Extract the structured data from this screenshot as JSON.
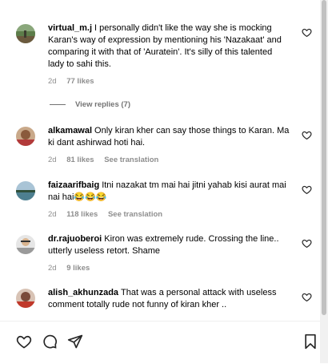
{
  "comments": [
    {
      "username": "virtual_m.j",
      "text": "I personally didn't like the way she is mocking Karan's way of expression by mentioning his 'Nazakaat' and comparing it with that of 'Auratein'. It's silly of this talented lady to sahi this.",
      "time": "2d",
      "likes": "77 likes",
      "see_translation": ""
    },
    {
      "username": "alkamawal",
      "text": "Only kiran kher can say those things to Karan. Ma ki dant ashirwad hoti hai.",
      "time": "2d",
      "likes": "81 likes",
      "see_translation": "See translation"
    },
    {
      "username": "faizaarifbaig",
      "text": "Itni nazakat tm mai hai jitni yahab kisi aurat mai nai hai😂😂😂",
      "time": "2d",
      "likes": "118 likes",
      "see_translation": "See translation"
    },
    {
      "username": "dr.rajuoberoi",
      "text": "Kiron was extremely rude. Crossing the line.. utterly useless retort. Shame",
      "time": "2d",
      "likes": "9 likes",
      "see_translation": ""
    },
    {
      "username": "alish_akhunzada",
      "text": "That was a personal attack with useless comment totally rude not funny of kiran kher ..",
      "time": "",
      "likes": "",
      "see_translation": ""
    }
  ],
  "view_replies": "View replies (7)",
  "icons": {
    "like": "heart-icon",
    "comment": "comment-icon",
    "share": "send-icon",
    "save": "bookmark-icon"
  },
  "colors": {
    "meta_gray": "#8e8e8e",
    "background": "#ffffff"
  }
}
